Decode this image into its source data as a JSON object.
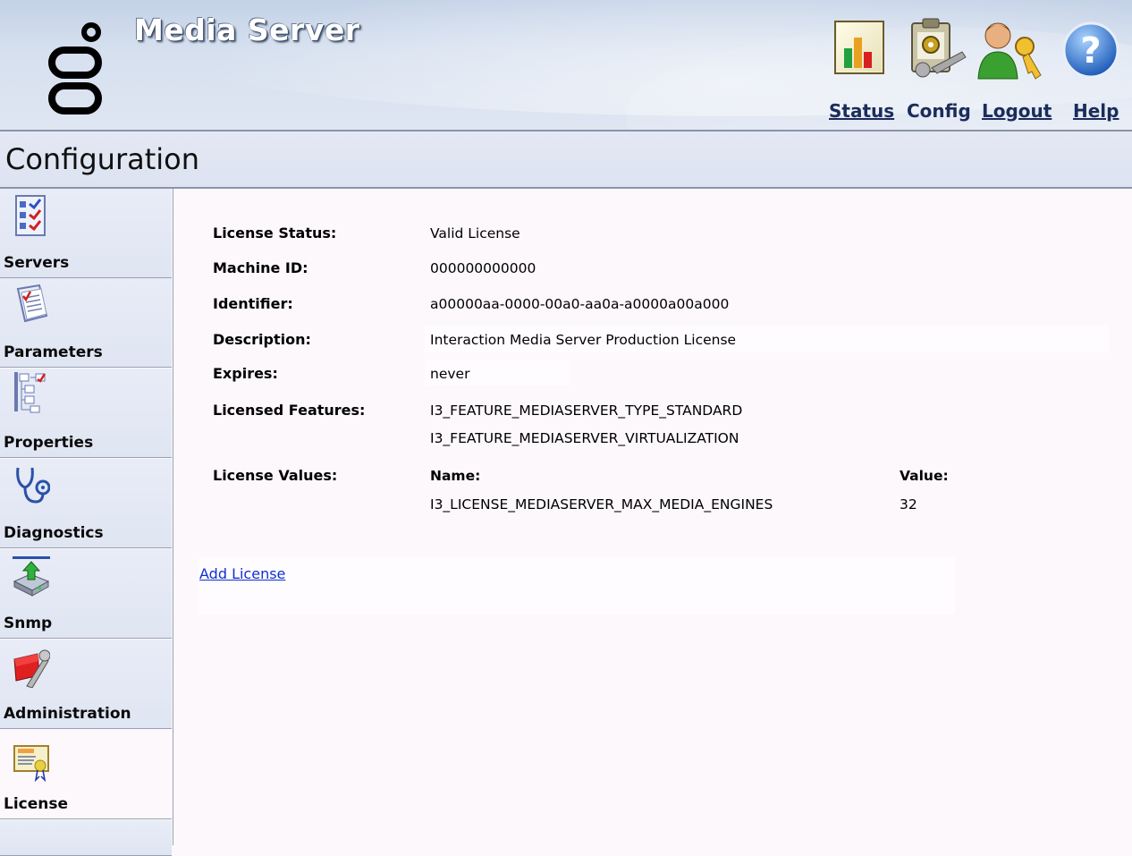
{
  "header": {
    "app_title": "Media Server",
    "nav": {
      "status": "Status",
      "config": "Config",
      "logout": "Logout",
      "help": "Help"
    },
    "icons": [
      "status-chart-icon",
      "config-clipboard-icon",
      "logout-user-key-icon",
      "help-question-icon"
    ]
  },
  "page": {
    "title": "Configuration"
  },
  "sidebar": {
    "items": [
      {
        "label": "Servers",
        "icon": "checklist-icon"
      },
      {
        "label": "Parameters",
        "icon": "document-icon"
      },
      {
        "label": "Properties",
        "icon": "tree-icon"
      },
      {
        "label": "Diagnostics",
        "icon": "stethoscope-icon"
      },
      {
        "label": "Snmp",
        "icon": "network-drive-icon"
      },
      {
        "label": "Administration",
        "icon": "toolbox-icon"
      },
      {
        "label": "License",
        "icon": "certificate-icon"
      }
    ],
    "active": "License"
  },
  "license": {
    "status_label": "License Status:",
    "status_value": "Valid License",
    "machine_id_label": "Machine ID:",
    "machine_id_value": "000000000000",
    "identifier_label": "Identifier:",
    "identifier_value": "a00000aa-0000-00a0-aa0a-a0000a00a000",
    "description_label": "Description:",
    "description_value": "Interaction Media Server Production License",
    "expires_label": "Expires:",
    "expires_value": "never",
    "features_label": "Licensed Features:",
    "features": [
      "I3_FEATURE_MEDIASERVER_TYPE_STANDARD",
      "I3_FEATURE_MEDIASERVER_VIRTUALIZATION"
    ],
    "values_label": "License Values:",
    "values_table": {
      "name_header": "Name:",
      "value_header": "Value:",
      "rows": [
        {
          "name": "I3_LICENSE_MEDIASERVER_MAX_MEDIA_ENGINES",
          "value": "32"
        }
      ]
    },
    "add_license_link": "Add License"
  }
}
